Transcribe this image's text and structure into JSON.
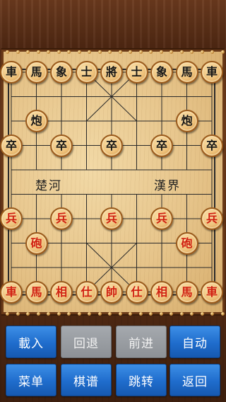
{
  "board": {
    "river_left": "楚河",
    "river_right": "漢界"
  },
  "pieces": [
    {
      "ch": "車",
      "side": "black",
      "col": 0,
      "row": 0
    },
    {
      "ch": "馬",
      "side": "black",
      "col": 1,
      "row": 0
    },
    {
      "ch": "象",
      "side": "black",
      "col": 2,
      "row": 0
    },
    {
      "ch": "士",
      "side": "black",
      "col": 3,
      "row": 0
    },
    {
      "ch": "將",
      "side": "black",
      "col": 4,
      "row": 0
    },
    {
      "ch": "士",
      "side": "black",
      "col": 5,
      "row": 0
    },
    {
      "ch": "象",
      "side": "black",
      "col": 6,
      "row": 0
    },
    {
      "ch": "馬",
      "side": "black",
      "col": 7,
      "row": 0
    },
    {
      "ch": "車",
      "side": "black",
      "col": 8,
      "row": 0
    },
    {
      "ch": "炮",
      "side": "black",
      "col": 1,
      "row": 2
    },
    {
      "ch": "炮",
      "side": "black",
      "col": 7,
      "row": 2
    },
    {
      "ch": "卒",
      "side": "black",
      "col": 0,
      "row": 3
    },
    {
      "ch": "卒",
      "side": "black",
      "col": 2,
      "row": 3
    },
    {
      "ch": "卒",
      "side": "black",
      "col": 4,
      "row": 3
    },
    {
      "ch": "卒",
      "side": "black",
      "col": 6,
      "row": 3
    },
    {
      "ch": "卒",
      "side": "black",
      "col": 8,
      "row": 3
    },
    {
      "ch": "兵",
      "side": "red",
      "col": 0,
      "row": 6
    },
    {
      "ch": "兵",
      "side": "red",
      "col": 2,
      "row": 6
    },
    {
      "ch": "兵",
      "side": "red",
      "col": 4,
      "row": 6
    },
    {
      "ch": "兵",
      "side": "red",
      "col": 6,
      "row": 6
    },
    {
      "ch": "兵",
      "side": "red",
      "col": 8,
      "row": 6
    },
    {
      "ch": "砲",
      "side": "red",
      "col": 1,
      "row": 7
    },
    {
      "ch": "砲",
      "side": "red",
      "col": 7,
      "row": 7
    },
    {
      "ch": "車",
      "side": "red",
      "col": 0,
      "row": 9
    },
    {
      "ch": "馬",
      "side": "red",
      "col": 1,
      "row": 9
    },
    {
      "ch": "相",
      "side": "red",
      "col": 2,
      "row": 9
    },
    {
      "ch": "仕",
      "side": "red",
      "col": 3,
      "row": 9
    },
    {
      "ch": "帥",
      "side": "red",
      "col": 4,
      "row": 9
    },
    {
      "ch": "仕",
      "side": "red",
      "col": 5,
      "row": 9
    },
    {
      "ch": "相",
      "side": "red",
      "col": 6,
      "row": 9
    },
    {
      "ch": "馬",
      "side": "red",
      "col": 7,
      "row": 9
    },
    {
      "ch": "車",
      "side": "red",
      "col": 8,
      "row": 9
    }
  ],
  "buttons": [
    {
      "name": "load-button",
      "label": "載入",
      "style": "blue"
    },
    {
      "name": "undo-button",
      "label": "回退",
      "style": "gray"
    },
    {
      "name": "redo-button",
      "label": "前进",
      "style": "gray"
    },
    {
      "name": "auto-button",
      "label": "自动",
      "style": "blue"
    },
    {
      "name": "menu-button",
      "label": "菜单",
      "style": "blue"
    },
    {
      "name": "manual-button",
      "label": "棋谱",
      "style": "blue"
    },
    {
      "name": "jump-button",
      "label": "跳转",
      "style": "blue"
    },
    {
      "name": "back-button",
      "label": "返回",
      "style": "blue"
    }
  ],
  "colors": {
    "red_piece_text": "#d01f10",
    "black_piece_text": "#161616",
    "blue_button": "#1f6ccc",
    "gray_button": "#8d9196"
  }
}
